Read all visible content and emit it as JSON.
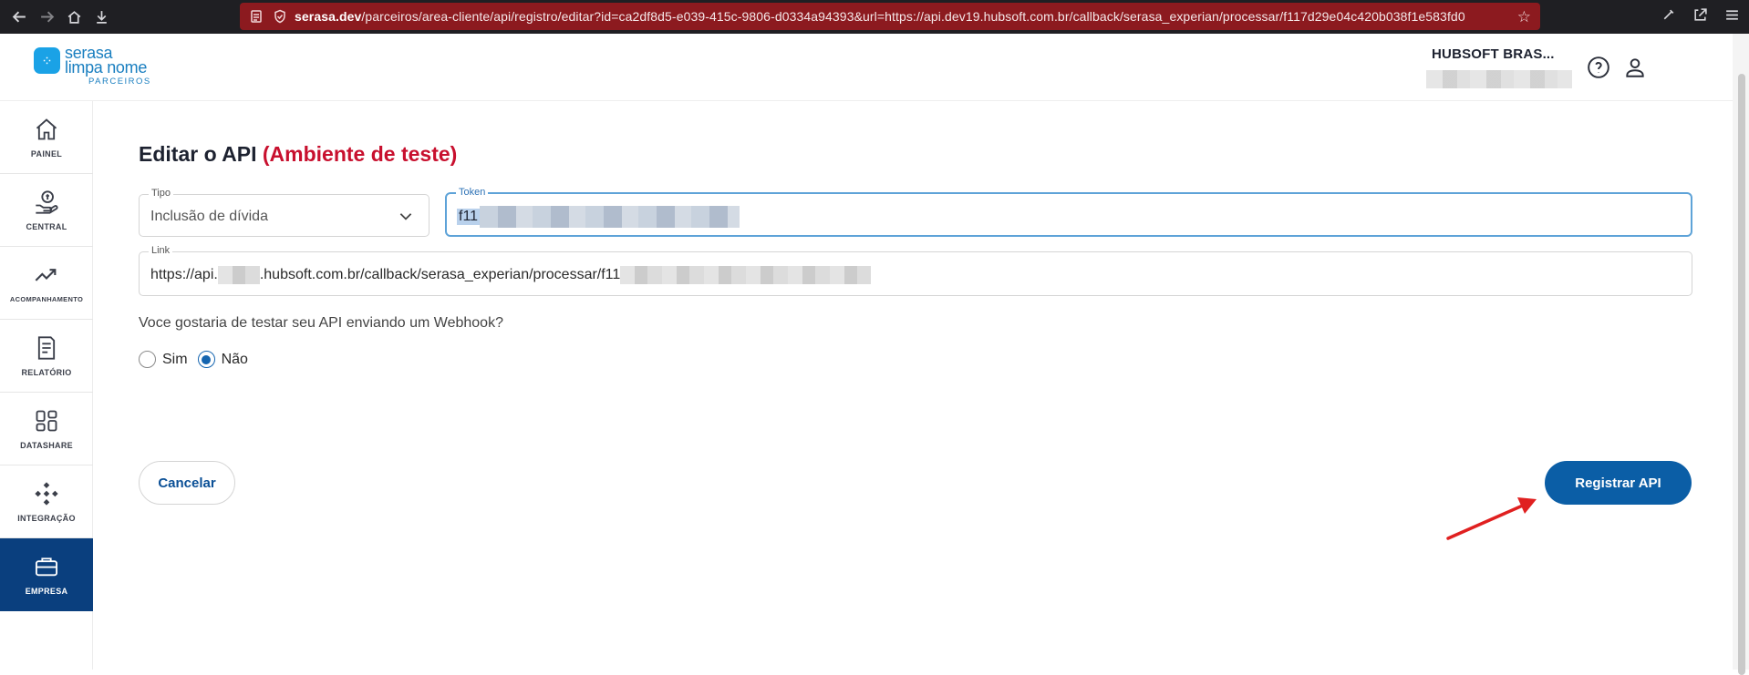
{
  "browser": {
    "url_domain": "serasa.dev",
    "url_rest": "/parceiros/area-cliente/api/registro/editar?id=ca2df8d5-e039-415c-9806-d0334a94393&url=https://api.dev19.hubsoft.com.br/callback/serasa_experian/processar/f117d29e04c420b038f1e583fd0"
  },
  "header": {
    "logo_line1": "serasa",
    "logo_line2": "limpa nome",
    "logo_sub": "PARCEIROS",
    "company_name": "HUBSOFT BRAS..."
  },
  "sidebar": {
    "items": [
      {
        "label": "PAINEL",
        "icon": "home-icon"
      },
      {
        "label": "CENTRAL",
        "icon": "money-hand-icon"
      },
      {
        "label": "ACOMPANHAMENTO",
        "icon": "trend-icon"
      },
      {
        "label": "RELATÓRIO",
        "icon": "report-icon"
      },
      {
        "label": "DATASHARE",
        "icon": "grid-icon"
      },
      {
        "label": "INTEGRAÇÃO",
        "icon": "integration-icon"
      },
      {
        "label": "EMPRESA",
        "icon": "briefcase-icon",
        "active": true
      }
    ]
  },
  "main": {
    "title": "Editar o API",
    "title_env": "(Ambiente de teste)",
    "tipo_label": "Tipo",
    "tipo_value": "Inclusão de dívida",
    "token_label": "Token",
    "token_value": "f11",
    "link_label": "Link",
    "link_prefix": "https://api.",
    "link_middle": ".hubsoft.com.br/callback/serasa_experian/processar/f11",
    "question": "Voce gostaria de testar seu API enviando um Webhook?",
    "radio_sim": "Sim",
    "radio_nao": "Não",
    "selected_radio": "Não",
    "cancel_label": "Cancelar",
    "register_label": "Registrar API"
  },
  "colors": {
    "brand_blue": "#0b5ea6",
    "env_red": "#c8102e",
    "sidebar_active": "#0a3f7e",
    "annotation_arrow": "#e02020"
  }
}
